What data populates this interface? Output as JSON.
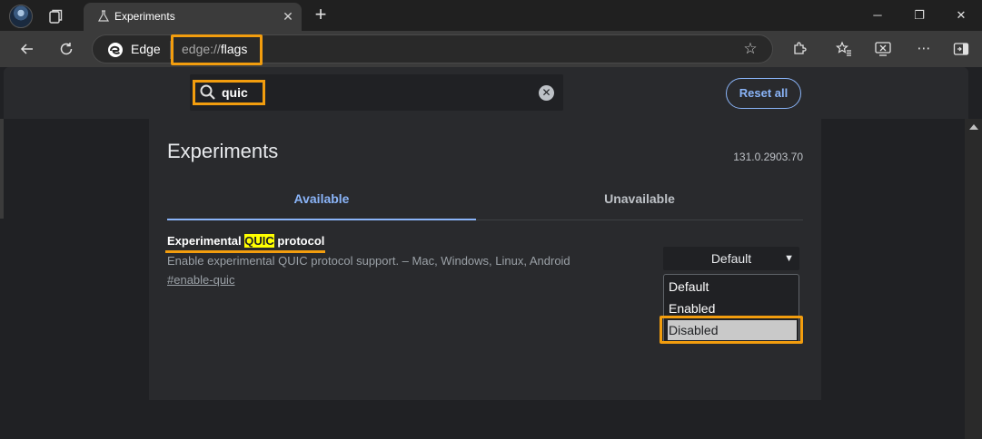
{
  "browser": {
    "tab": {
      "title": "Experiments",
      "close": "✕"
    },
    "new_tab": "+",
    "window_controls": {
      "minimize": "─",
      "restore": "❐",
      "close": "✕"
    },
    "omnibox": {
      "brand": "Edge",
      "url_scheme": "edge://",
      "url_path": "flags"
    },
    "toolbar_icons": [
      "extensions-icon",
      "favorites-icon",
      "screenshot-icon",
      "more-icon",
      "sidebar-icon"
    ]
  },
  "search": {
    "value": "quic",
    "clear": "✕"
  },
  "reset_all": "Reset all",
  "page": {
    "title": "Experiments",
    "version": "131.0.2903.70",
    "tabs": {
      "available": "Available",
      "unavailable": "Unavailable"
    }
  },
  "flag": {
    "title_before": "Experimental ",
    "title_match": "QUIC",
    "title_after": " protocol",
    "description": "Enable experimental QUIC protocol support. – Mac, Windows, Linux, Android",
    "link": "#enable-quic",
    "selected": "Default",
    "options": [
      "Default",
      "Enabled",
      "Disabled"
    ],
    "highlighted_option": "Disabled"
  },
  "colors": {
    "accent": "#8ab4f8",
    "annotation": "#f29d0e",
    "match_highlight": "#ffff00"
  }
}
